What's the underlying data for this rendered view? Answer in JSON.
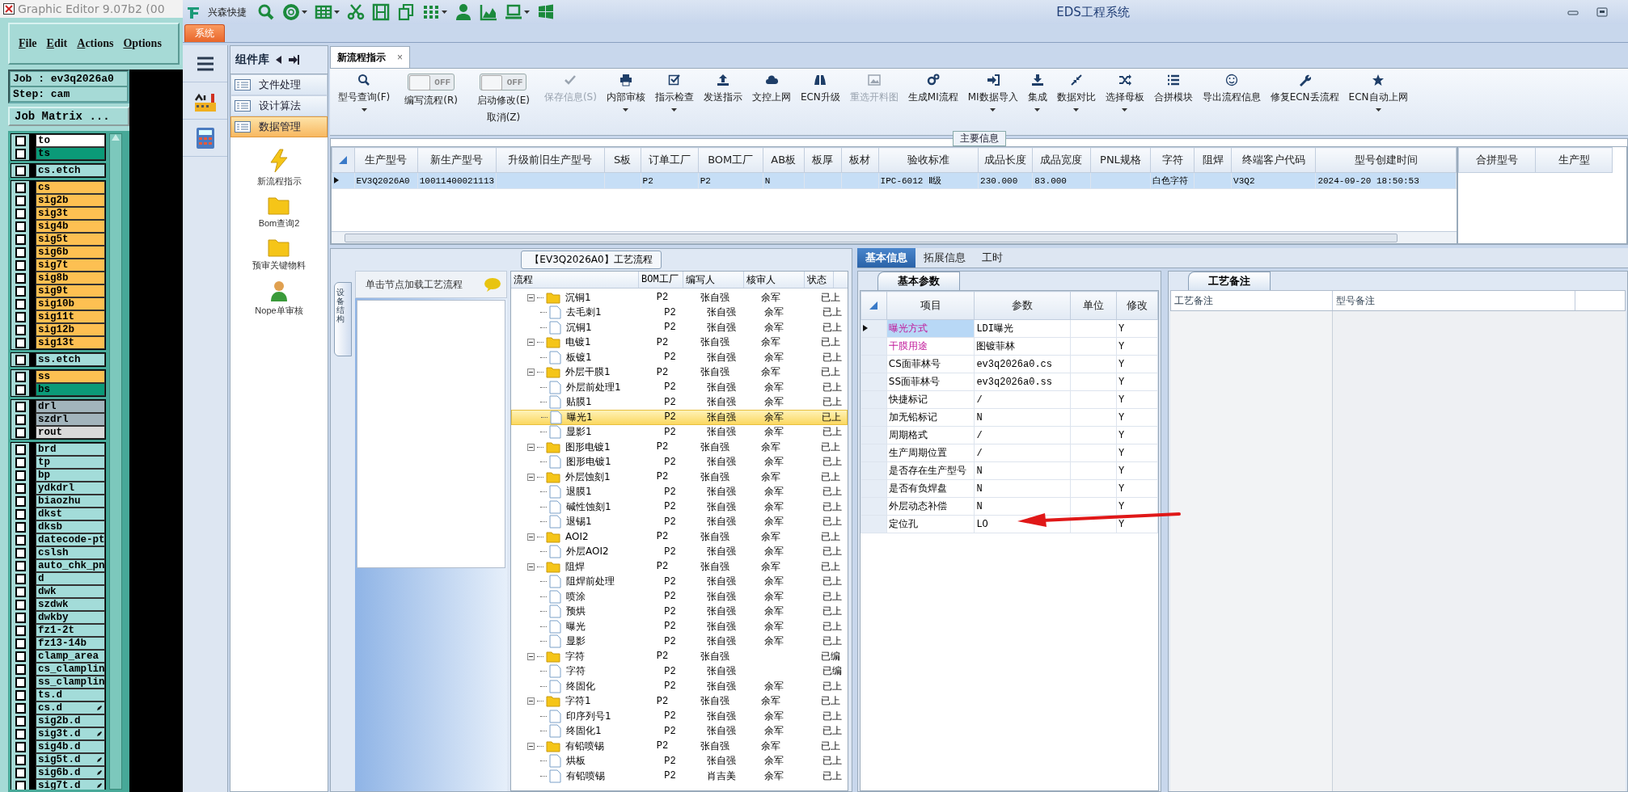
{
  "editor": {
    "title": "Graphic Editor 9.07b2 (00",
    "menu": [
      "File",
      "Edit",
      "Actions",
      "Options"
    ],
    "job": "Job : ev3q2026a0",
    "step": "Step: cam",
    "matrix_button": "Job Matrix ...",
    "layer_groups": [
      {
        "layers": [
          {
            "name": "to",
            "color": "#ffffff",
            "checked": false,
            "marked": false
          },
          {
            "name": "ts",
            "color": "#0b9a78",
            "checked": false,
            "marked": false
          }
        ]
      },
      {
        "layers": [
          {
            "name": "cs.etch",
            "color": "#a3dcd9",
            "checked": false,
            "marked": false
          }
        ]
      },
      {
        "layers": [
          {
            "name": "cs",
            "color": "#fdc052",
            "checked": false,
            "marked": false
          },
          {
            "name": "sig2b",
            "color": "#fdc052",
            "checked": false,
            "marked": false
          },
          {
            "name": "sig3t",
            "color": "#fdc052",
            "checked": false,
            "marked": false
          },
          {
            "name": "sig4b",
            "color": "#fdc052",
            "checked": false,
            "marked": false
          },
          {
            "name": "sig5t",
            "color": "#fdc052",
            "checked": false,
            "marked": false
          },
          {
            "name": "sig6b",
            "color": "#fdc052",
            "checked": false,
            "marked": false
          },
          {
            "name": "sig7t",
            "color": "#fdc052",
            "checked": false,
            "marked": false
          },
          {
            "name": "sig8b",
            "color": "#fdc052",
            "checked": false,
            "marked": false
          },
          {
            "name": "sig9t",
            "color": "#fdc052",
            "checked": false,
            "marked": false
          },
          {
            "name": "sig10b",
            "color": "#fdc052",
            "checked": false,
            "marked": false
          },
          {
            "name": "sig11t",
            "color": "#fdc052",
            "checked": false,
            "marked": false
          },
          {
            "name": "sig12b",
            "color": "#fdc052",
            "checked": false,
            "marked": false
          },
          {
            "name": "sig13t",
            "color": "#fdc052",
            "checked": false,
            "marked": false
          }
        ]
      },
      {
        "layers": [
          {
            "name": "ss.etch",
            "color": "#a3dcd9",
            "checked": false,
            "marked": false
          }
        ]
      },
      {
        "layers": [
          {
            "name": "ss",
            "color": "#fdc052",
            "checked": false,
            "marked": false
          },
          {
            "name": "bs",
            "color": "#0b9a78",
            "checked": false,
            "marked": false
          }
        ]
      },
      {
        "layers": [
          {
            "name": "drl",
            "color": "#a2b4bc",
            "checked": false,
            "marked": false
          },
          {
            "name": "szdrl",
            "color": "#a2b4bc",
            "checked": false,
            "marked": false
          },
          {
            "name": "rout",
            "color": "#dadada",
            "checked": false,
            "marked": false
          }
        ]
      },
      {
        "layers": [
          {
            "name": "brd",
            "color": "#a3dcd9",
            "checked": false,
            "marked": false
          },
          {
            "name": "tp",
            "color": "#a3dcd9",
            "checked": false,
            "marked": false
          },
          {
            "name": "bp",
            "color": "#a3dcd9",
            "checked": false,
            "marked": false
          },
          {
            "name": "ydkdrl",
            "color": "#a3dcd9",
            "checked": false,
            "marked": false
          },
          {
            "name": "biaozhu",
            "color": "#a3dcd9",
            "checked": false,
            "marked": false
          },
          {
            "name": "dkst",
            "color": "#a3dcd9",
            "checked": false,
            "marked": false
          },
          {
            "name": "dksb",
            "color": "#a3dcd9",
            "checked": false,
            "marked": false
          },
          {
            "name": "datecode-pt",
            "color": "#a3dcd9",
            "checked": false,
            "marked": false
          },
          {
            "name": "cslsh",
            "color": "#a3dcd9",
            "checked": false,
            "marked": false
          },
          {
            "name": "auto_chk_pn",
            "color": "#a3dcd9",
            "checked": false,
            "marked": false
          },
          {
            "name": "d",
            "color": "#a3dcd9",
            "checked": false,
            "marked": false
          },
          {
            "name": "dwk",
            "color": "#a3dcd9",
            "checked": false,
            "marked": false
          },
          {
            "name": "szdwk",
            "color": "#a3dcd9",
            "checked": false,
            "marked": false
          },
          {
            "name": "dwkby",
            "color": "#a3dcd9",
            "checked": false,
            "marked": false
          },
          {
            "name": "fz1-2t",
            "color": "#a3dcd9",
            "checked": false,
            "marked": false
          },
          {
            "name": "fz13-14b",
            "color": "#a3dcd9",
            "checked": false,
            "marked": false
          },
          {
            "name": "clamp_area",
            "color": "#a3dcd9",
            "checked": false,
            "marked": false
          },
          {
            "name": "cs_clamplin",
            "color": "#a3dcd9",
            "checked": false,
            "marked": false
          },
          {
            "name": "ss_clamplin",
            "color": "#a3dcd9",
            "checked": false,
            "marked": false
          },
          {
            "name": "ts.d",
            "color": "#a3dcd9",
            "checked": false,
            "marked": false
          },
          {
            "name": "cs.d",
            "color": "#a3dcd9",
            "checked": false,
            "marked": true
          },
          {
            "name": "sig2b.d",
            "color": "#a3dcd9",
            "checked": false,
            "marked": false
          },
          {
            "name": "sig3t.d",
            "color": "#a3dcd9",
            "checked": false,
            "marked": true
          },
          {
            "name": "sig4b.d",
            "color": "#a3dcd9",
            "checked": false,
            "marked": false
          },
          {
            "name": "sig5t.d",
            "color": "#a3dcd9",
            "checked": false,
            "marked": true
          },
          {
            "name": "sig6b.d",
            "color": "#a3dcd9",
            "checked": false,
            "marked": true
          },
          {
            "name": "sig7t.d",
            "color": "#a3dcd9",
            "checked": false,
            "marked": true
          }
        ]
      }
    ]
  },
  "app": {
    "brand": "兴森快捷",
    "title": "EDS工程系统",
    "system_tab": "系统"
  },
  "component_panel": {
    "title": "组件库",
    "items": [
      {
        "label": "文件处理",
        "selected": false
      },
      {
        "label": "设计算法",
        "selected": false
      },
      {
        "label": "数据管理",
        "selected": true
      }
    ],
    "tools": [
      "新流程指示",
      "Bom查询2",
      "预审关键物料",
      "Nope单审核"
    ]
  },
  "document_tab": {
    "label": "新流程指示",
    "close": "×"
  },
  "toolbar": [
    {
      "kind": "button",
      "label": "型号查询(F)",
      "dropdown": true,
      "disabled": false
    },
    {
      "kind": "toggle",
      "label": "编写流程(R)",
      "switch_text": "OFF",
      "on": false
    },
    {
      "kind": "toggle",
      "label": "启动修改(E)",
      "second_label": "取消(Z)",
      "switch_text": "OFF",
      "on": false
    },
    {
      "kind": "button",
      "label": "保存信息(S)",
      "dropdown": false,
      "disabled": true
    },
    {
      "kind": "button",
      "label": "内部审核",
      "dropdown": true,
      "disabled": false
    },
    {
      "kind": "button",
      "label": "指示检查",
      "dropdown": true,
      "disabled": false
    },
    {
      "kind": "button",
      "label": "发送指示",
      "dropdown": false,
      "disabled": false
    },
    {
      "kind": "button",
      "label": "文控上网",
      "dropdown": false,
      "disabled": false
    },
    {
      "kind": "button",
      "label": "ECN升级",
      "dropdown": false,
      "disabled": false
    },
    {
      "kind": "button",
      "label": "重选开料图",
      "dropdown": false,
      "disabled": true
    },
    {
      "kind": "button",
      "label": "生成MI流程",
      "dropdown": false,
      "disabled": false
    },
    {
      "kind": "button",
      "label": "MI数据导入",
      "dropdown": true,
      "disabled": false
    },
    {
      "kind": "button",
      "label": "集成",
      "dropdown": true,
      "disabled": false
    },
    {
      "kind": "button",
      "label": "数据对比",
      "dropdown": true,
      "disabled": false
    },
    {
      "kind": "button",
      "label": "选择母板",
      "dropdown": true,
      "disabled": false
    },
    {
      "kind": "button",
      "label": "合拼模块",
      "dropdown": false,
      "disabled": false
    },
    {
      "kind": "button",
      "label": "导出流程信息",
      "dropdown": false,
      "disabled": false
    },
    {
      "kind": "button",
      "label": "修复ECN丢流程",
      "dropdown": false,
      "disabled": false
    },
    {
      "kind": "button",
      "label": "ECN自动上网",
      "dropdown": true,
      "disabled": false
    }
  ],
  "main_info": {
    "title": "主要信息",
    "columns": [
      "生产型号",
      "新生产型号",
      "升级前旧生产型号",
      "S板",
      "订单工厂",
      "BOM工厂",
      "AB板",
      "板厚",
      "板材",
      "验收标准",
      "成品长度",
      "成品宽度",
      "PNL规格",
      "字符",
      "阻焊",
      "终端客户代码",
      "型号创建时间"
    ],
    "rows": [
      {
        "selected": true,
        "cells": [
          "EV3Q2026A0",
          "10011400021113",
          null,
          null,
          "P2",
          "P2",
          "N",
          null,
          null,
          "IPC-6012 Ⅱ级",
          "230.000",
          "83.000",
          null,
          "白色字符",
          null,
          "V3Q2",
          "2024-09-20 18:50:53"
        ]
      }
    ],
    "side_columns": [
      "合拼型号",
      "生产型"
    ]
  },
  "process": {
    "title": "【EV3Q2026A0】工艺流程",
    "side_tab": "设备结构",
    "nav_hint": "单击节点加载工艺流程",
    "columns": [
      "流程",
      "BOM工厂",
      "编写人",
      "核审人",
      "状态"
    ],
    "nodes": [
      {
        "name": "沉铜1",
        "bom": "P2",
        "writer": "张自强",
        "reviewer": "余军",
        "status": "已上",
        "expanded": true,
        "selected": false,
        "children": [
          {
            "name": "去毛刺1",
            "bom": "P2",
            "writer": "张自强",
            "reviewer": "余军",
            "status": "已上",
            "selected": false
          },
          {
            "name": "沉铜1",
            "bom": "P2",
            "writer": "张自强",
            "reviewer": "余军",
            "status": "已上",
            "selected": false
          }
        ]
      },
      {
        "name": "电镀1",
        "bom": "P2",
        "writer": "张自强",
        "reviewer": "余军",
        "status": "已上",
        "expanded": true,
        "selected": false,
        "children": [
          {
            "name": "板镀1",
            "bom": "P2",
            "writer": "张自强",
            "reviewer": "余军",
            "status": "已上",
            "selected": false
          }
        ]
      },
      {
        "name": "外层干膜1",
        "bom": "P2",
        "writer": "张自强",
        "reviewer": "余军",
        "status": "已上",
        "expanded": true,
        "selected": false,
        "children": [
          {
            "name": "外层前处理1",
            "bom": "P2",
            "writer": "张自强",
            "reviewer": "余军",
            "status": "已上",
            "selected": false
          },
          {
            "name": "贴膜1",
            "bom": "P2",
            "writer": "张自强",
            "reviewer": "余军",
            "status": "已上",
            "selected": false
          },
          {
            "name": "曝光1",
            "bom": "P2",
            "writer": "张自强",
            "reviewer": "余军",
            "status": "已上",
            "selected": true
          },
          {
            "name": "显影1",
            "bom": "P2",
            "writer": "张自强",
            "reviewer": "余军",
            "status": "已上",
            "selected": false
          }
        ]
      },
      {
        "name": "图形电镀1",
        "bom": "P2",
        "writer": "张自强",
        "reviewer": "余军",
        "status": "已上",
        "expanded": true,
        "selected": false,
        "children": [
          {
            "name": "图形电镀1",
            "bom": "P2",
            "writer": "张自强",
            "reviewer": "余军",
            "status": "已上",
            "selected": false
          }
        ]
      },
      {
        "name": "外层蚀刻1",
        "bom": "P2",
        "writer": "张自强",
        "reviewer": "余军",
        "status": "已上",
        "expanded": true,
        "selected": false,
        "children": [
          {
            "name": "退膜1",
            "bom": "P2",
            "writer": "张自强",
            "reviewer": "余军",
            "status": "已上",
            "selected": false
          },
          {
            "name": "碱性蚀刻1",
            "bom": "P2",
            "writer": "张自强",
            "reviewer": "余军",
            "status": "已上",
            "selected": false
          },
          {
            "name": "退锡1",
            "bom": "P2",
            "writer": "张自强",
            "reviewer": "余军",
            "status": "已上",
            "selected": false
          }
        ]
      },
      {
        "name": "AOI2",
        "bom": "P2",
        "writer": "张自强",
        "reviewer": "余军",
        "status": "已上",
        "expanded": true,
        "selected": false,
        "children": [
          {
            "name": "外层AOI2",
            "bom": "P2",
            "writer": "张自强",
            "reviewer": "余军",
            "status": "已上",
            "selected": false
          }
        ]
      },
      {
        "name": "阻焊",
        "bom": "P2",
        "writer": "张自强",
        "reviewer": "余军",
        "status": "已上",
        "expanded": true,
        "selected": false,
        "children": [
          {
            "name": "阻焊前处理",
            "bom": "P2",
            "writer": "张自强",
            "reviewer": "余军",
            "status": "已上",
            "selected": false
          },
          {
            "name": "喷涂",
            "bom": "P2",
            "writer": "张自强",
            "reviewer": "余军",
            "status": "已上",
            "selected": false
          },
          {
            "name": "预烘",
            "bom": "P2",
            "writer": "张自强",
            "reviewer": "余军",
            "status": "已上",
            "selected": false
          },
          {
            "name": "曝光",
            "bom": "P2",
            "writer": "张自强",
            "reviewer": "余军",
            "status": "已上",
            "selected": false
          },
          {
            "name": "显影",
            "bom": "P2",
            "writer": "张自强",
            "reviewer": "余军",
            "status": "已上",
            "selected": false
          }
        ]
      },
      {
        "name": "字符",
        "bom": "P2",
        "writer": "张自强",
        "status": "已编",
        "expanded": true,
        "selected": false,
        "children": [
          {
            "name": "字符",
            "bom": "P2",
            "writer": "张自强",
            "status": "已编",
            "selected": false
          },
          {
            "name": "终固化",
            "bom": "P2",
            "writer": "张自强",
            "reviewer": "余军",
            "status": "已上",
            "selected": false
          }
        ]
      },
      {
        "name": "字符1",
        "bom": "P2",
        "writer": "张自强",
        "reviewer": "余军",
        "status": "已上",
        "expanded": true,
        "selected": false,
        "children": [
          {
            "name": "印序列号1",
            "bom": "P2",
            "writer": "张自强",
            "reviewer": "余军",
            "status": "已上",
            "selected": false
          },
          {
            "name": "终固化1",
            "bom": "P2",
            "writer": "张自强",
            "reviewer": "余军",
            "status": "已上",
            "selected": false
          }
        ]
      },
      {
        "name": "有铅喷锡",
        "bom": "P2",
        "writer": "张自强",
        "reviewer": "余军",
        "status": "已上",
        "expanded": true,
        "selected": false,
        "children": [
          {
            "name": "烘板",
            "bom": "P2",
            "writer": "张自强",
            "reviewer": "余军",
            "status": "已上",
            "selected": false
          },
          {
            "name": "有铅喷锡",
            "bom": "P2",
            "writer": "肖吉美",
            "reviewer": "余军",
            "status": "已上",
            "selected": false
          }
        ]
      }
    ]
  },
  "detail": {
    "tabs": [
      {
        "label": "基本信息",
        "selected": true
      },
      {
        "label": "拓展信息",
        "selected": false
      },
      {
        "label": "工时",
        "selected": false
      }
    ],
    "params": {
      "title": "基本参数",
      "columns": [
        "项目",
        "参数",
        "单位",
        "修改"
      ],
      "rows": [
        {
          "item": "曝光方式",
          "value": "LDI曝光",
          "modified": "Y",
          "highlighted": true,
          "selected": true
        },
        {
          "item": "干膜用途",
          "value": "图镀菲林",
          "modified": "Y",
          "highlighted": true,
          "selected": false
        },
        {
          "item": "CS面菲林号",
          "value": "ev3q2026a0.cs",
          "modified": "Y",
          "highlighted": false,
          "selected": false
        },
        {
          "item": "SS面菲林号",
          "value": "ev3q2026a0.ss",
          "modified": "Y",
          "highlighted": false,
          "selected": false
        },
        {
          "item": "快捷标记",
          "value": "/",
          "modified": "Y",
          "highlighted": false,
          "selected": false
        },
        {
          "item": "加无铅标记",
          "value": "N",
          "modified": "Y",
          "highlighted": false,
          "selected": false
        },
        {
          "item": "周期格式",
          "value": "/",
          "modified": "Y",
          "highlighted": false,
          "selected": false
        },
        {
          "item": "生产周期位置",
          "value": "/",
          "modified": "Y",
          "highlighted": false,
          "selected": false
        },
        {
          "item": "是否存在生产型号",
          "value": "N",
          "modified": "Y",
          "highlighted": false,
          "selected": false
        },
        {
          "item": "是否有负焊盘",
          "value": "N",
          "modified": "Y",
          "highlighted": false,
          "selected": false
        },
        {
          "item": "外层动态补偿",
          "value": "N",
          "modified": "Y",
          "highlighted": false,
          "selected": false
        },
        {
          "item": "定位孔",
          "value": "LO",
          "modified": "Y",
          "highlighted": false,
          "selected": false
        }
      ]
    },
    "notes": {
      "title": "工艺备注",
      "columns": [
        "工艺备注",
        "型号备注"
      ]
    }
  }
}
